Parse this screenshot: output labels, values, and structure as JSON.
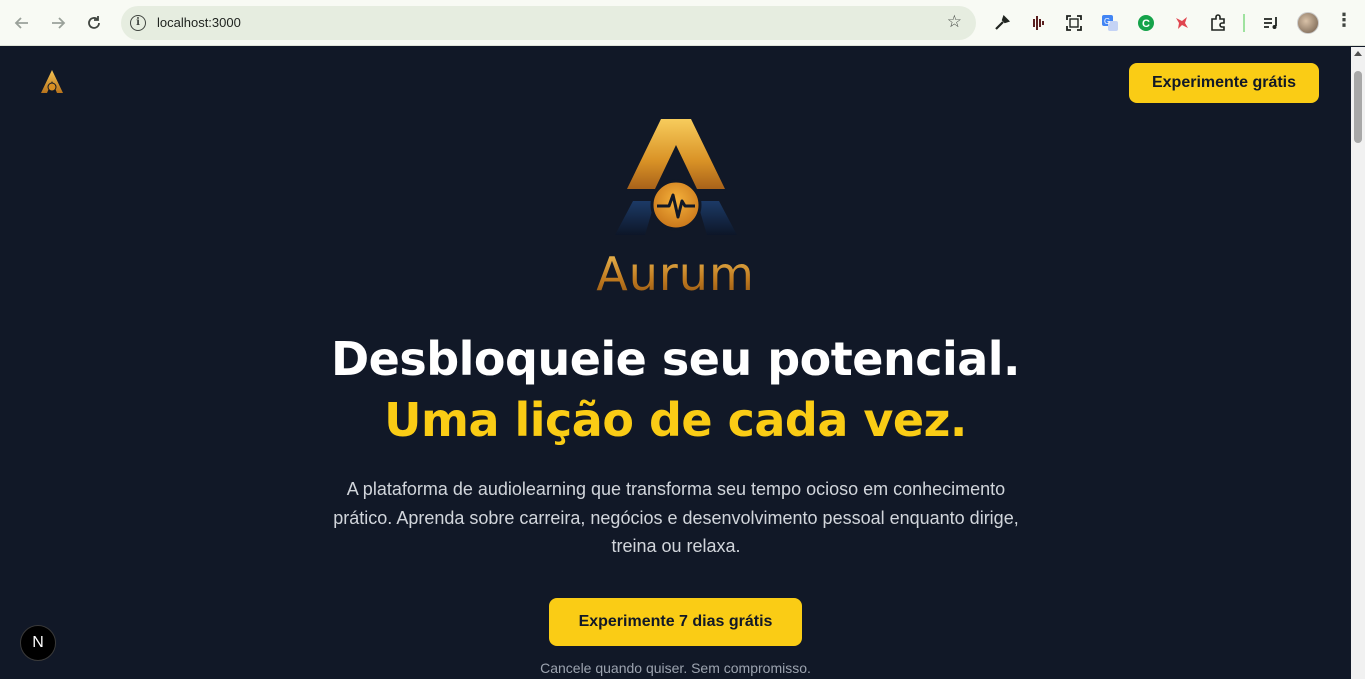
{
  "browser": {
    "url": "localhost:3000",
    "back_icon": "arrow-left-icon",
    "forward_icon": "arrow-right-icon",
    "reload_icon": "reload-icon",
    "bookmark_icon": "star-icon",
    "extensions": [
      "eyedropper-icon",
      "audio-wave-icon",
      "screenshot-icon",
      "translate-icon",
      "grammar-icon",
      "bird-icon",
      "puzzle-icon",
      "media-icon"
    ],
    "menu_icon": "kebab-icon"
  },
  "header": {
    "cta_label": "Experimente grátis"
  },
  "hero": {
    "brand_name": "Aurum",
    "headline_line1": "Desbloqueie seu potencial.",
    "headline_line2": "Uma lição de cada vez.",
    "subtitle": "A plataforma de audiolearning que transforma seu tempo ocioso em conhecimento prático. Aprenda sobre carreira, negócios e desenvolvimento pessoal enquanto dirige, treina ou relaxa.",
    "cta_label": "Experimente 7 dias grátis",
    "note": "Cancele quando quiser. Sem compromisso."
  },
  "dev_badge": {
    "label": "N"
  },
  "colors": {
    "background": "#111827",
    "accent": "#facc15",
    "brand_gold": "#c98a2b"
  }
}
